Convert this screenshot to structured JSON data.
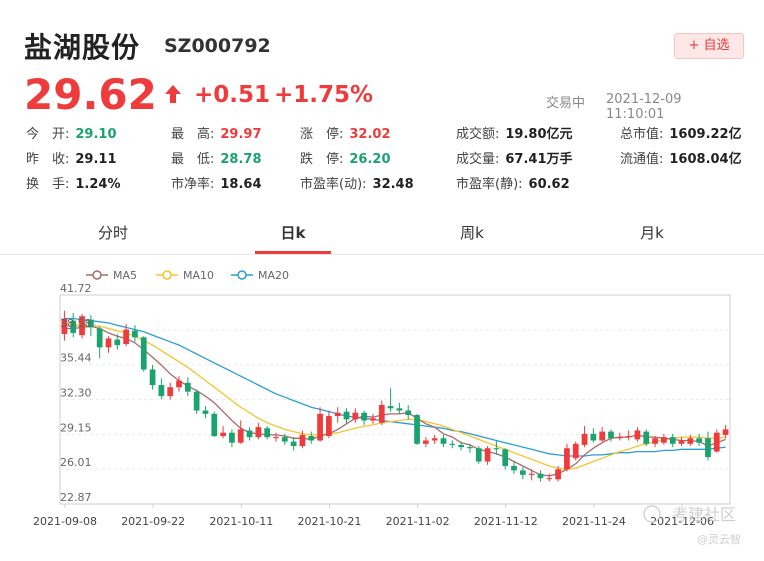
{
  "header": {
    "stock_name": "盐湖股份",
    "stock_code": "SZ000792",
    "add_watch_label": "+ 自选"
  },
  "quote": {
    "price": "29.62",
    "change": "+0.51",
    "change_pct": "+1.75%",
    "status": "交易中",
    "timestamp": "2021-12-09 11:10:01"
  },
  "stats": {
    "open_label": "今　开:",
    "open": "29.10",
    "prev_close_label": "昨　收:",
    "prev_close": "29.11",
    "turnover_rate_label": "换　手:",
    "turnover_rate": "1.24%",
    "high_label": "最　高:",
    "high": "29.97",
    "low_label": "最　低:",
    "low": "28.78",
    "pb_label": "市净率:",
    "pb": "18.64",
    "limit_up_label": "涨　停:",
    "limit_up": "32.02",
    "limit_down_label": "跌　停:",
    "limit_down": "26.20",
    "pe_dyn_label": "市盈率(动):",
    "pe_dyn": "32.48",
    "amount_label": "成交额:",
    "amount": "19.80亿元",
    "volume_label": "成交量:",
    "volume": "67.41万手",
    "pe_static_label": "市盈率(静):",
    "pe_static": "60.62",
    "market_cap_label": "总市值:",
    "market_cap": "1609.22亿",
    "float_cap_label": "流通值:",
    "float_cap": "1608.04亿"
  },
  "tabs": [
    "分时",
    "日k",
    "周k",
    "月k"
  ],
  "active_tab": "日k",
  "watermark": {
    "brand": "考建社区",
    "author": "@灵云智"
  },
  "colors": {
    "up": "#ef3b3b",
    "down": "#1aa36f",
    "ma5": "#a86b6b",
    "ma10": "#f5c431",
    "ma20": "#2a9fd0"
  },
  "chart_data": {
    "type": "candlestick",
    "legend": [
      "MA5",
      "MA10",
      "MA20"
    ],
    "y_ticks": [
      "41.72",
      "38.58",
      "35.44",
      "32.30",
      "29.15",
      "26.01",
      "22.87"
    ],
    "ylim": [
      22.87,
      41.72
    ],
    "x_ticks": [
      "2021-09-08",
      "2021-09-22",
      "2021-10-11",
      "2021-10-21",
      "2021-11-02",
      "2021-11-12",
      "2021-11-24",
      "2021-12-06"
    ],
    "candles": [
      {
        "o": 38.2,
        "c": 39.6,
        "h": 40.3,
        "l": 37.6
      },
      {
        "o": 39.4,
        "c": 38.3,
        "h": 40.1,
        "l": 37.9
      },
      {
        "o": 38.1,
        "c": 39.8,
        "h": 40.0,
        "l": 37.8
      },
      {
        "o": 39.5,
        "c": 38.8,
        "h": 39.9,
        "l": 38.0
      },
      {
        "o": 38.7,
        "c": 37.0,
        "h": 38.9,
        "l": 36.0
      },
      {
        "o": 37.0,
        "c": 37.8,
        "h": 38.0,
        "l": 36.5
      },
      {
        "o": 37.7,
        "c": 37.2,
        "h": 38.2,
        "l": 36.8
      },
      {
        "o": 37.3,
        "c": 38.6,
        "h": 39.1,
        "l": 37.1
      },
      {
        "o": 38.5,
        "c": 37.9,
        "h": 39.0,
        "l": 37.5
      },
      {
        "o": 37.9,
        "c": 35.0,
        "h": 38.0,
        "l": 34.8
      },
      {
        "o": 35.0,
        "c": 33.6,
        "h": 35.4,
        "l": 33.2
      },
      {
        "o": 33.6,
        "c": 32.6,
        "h": 34.2,
        "l": 32.3
      },
      {
        "o": 32.6,
        "c": 33.4,
        "h": 33.8,
        "l": 32.3
      },
      {
        "o": 33.4,
        "c": 34.0,
        "h": 34.4,
        "l": 33.0
      },
      {
        "o": 33.8,
        "c": 33.0,
        "h": 34.3,
        "l": 32.6
      },
      {
        "o": 33.0,
        "c": 31.3,
        "h": 33.2,
        "l": 31.0
      },
      {
        "o": 31.3,
        "c": 31.0,
        "h": 31.7,
        "l": 30.6
      },
      {
        "o": 31.0,
        "c": 29.0,
        "h": 31.2,
        "l": 28.9
      },
      {
        "o": 29.0,
        "c": 29.3,
        "h": 29.9,
        "l": 28.8
      },
      {
        "o": 29.3,
        "c": 28.4,
        "h": 29.6,
        "l": 28.0
      },
      {
        "o": 28.4,
        "c": 29.6,
        "h": 30.4,
        "l": 28.3
      },
      {
        "o": 29.5,
        "c": 28.9,
        "h": 29.8,
        "l": 28.6
      },
      {
        "o": 28.9,
        "c": 29.8,
        "h": 30.2,
        "l": 28.7
      },
      {
        "o": 29.7,
        "c": 28.9,
        "h": 29.9,
        "l": 28.7
      },
      {
        "o": 28.9,
        "c": 28.9,
        "h": 29.3,
        "l": 28.5
      },
      {
        "o": 28.9,
        "c": 28.5,
        "h": 29.2,
        "l": 28.2
      },
      {
        "o": 28.5,
        "c": 28.1,
        "h": 28.9,
        "l": 27.7
      },
      {
        "o": 28.1,
        "c": 29.1,
        "h": 29.5,
        "l": 27.9
      },
      {
        "o": 29.0,
        "c": 28.6,
        "h": 29.4,
        "l": 28.3
      },
      {
        "o": 28.6,
        "c": 31.0,
        "h": 31.6,
        "l": 28.5
      },
      {
        "o": 29.0,
        "c": 30.8,
        "h": 31.3,
        "l": 28.8
      },
      {
        "o": 30.8,
        "c": 31.1,
        "h": 31.6,
        "l": 30.2
      },
      {
        "o": 31.2,
        "c": 30.5,
        "h": 31.5,
        "l": 30.1
      },
      {
        "o": 30.5,
        "c": 31.1,
        "h": 31.5,
        "l": 30.2
      },
      {
        "o": 31.1,
        "c": 30.4,
        "h": 31.3,
        "l": 30.0
      },
      {
        "o": 30.4,
        "c": 30.6,
        "h": 31.0,
        "l": 30.1
      },
      {
        "o": 30.2,
        "c": 31.8,
        "h": 32.2,
        "l": 30.0
      },
      {
        "o": 31.7,
        "c": 31.5,
        "h": 33.3,
        "l": 31.2
      },
      {
        "o": 31.5,
        "c": 31.3,
        "h": 32.0,
        "l": 31.0
      },
      {
        "o": 31.3,
        "c": 30.9,
        "h": 31.8,
        "l": 30.5
      },
      {
        "o": 30.9,
        "c": 28.3,
        "h": 31.0,
        "l": 28.2
      },
      {
        "o": 28.3,
        "c": 28.6,
        "h": 28.9,
        "l": 28.0
      },
      {
        "o": 28.6,
        "c": 28.8,
        "h": 29.1,
        "l": 28.3
      },
      {
        "o": 28.8,
        "c": 28.3,
        "h": 29.1,
        "l": 28.0
      },
      {
        "o": 28.3,
        "c": 28.2,
        "h": 28.6,
        "l": 27.9
      },
      {
        "o": 28.2,
        "c": 28.0,
        "h": 28.5,
        "l": 27.7
      },
      {
        "o": 28.0,
        "c": 27.9,
        "h": 28.3,
        "l": 27.5
      },
      {
        "o": 27.9,
        "c": 26.7,
        "h": 28.1,
        "l": 26.5
      },
      {
        "o": 26.7,
        "c": 27.9,
        "h": 28.1,
        "l": 26.4
      },
      {
        "o": 27.9,
        "c": 27.8,
        "h": 28.6,
        "l": 27.3
      },
      {
        "o": 27.8,
        "c": 26.3,
        "h": 27.9,
        "l": 26.0
      },
      {
        "o": 26.3,
        "c": 25.9,
        "h": 26.7,
        "l": 25.6
      },
      {
        "o": 25.9,
        "c": 25.5,
        "h": 26.2,
        "l": 25.1
      },
      {
        "o": 25.5,
        "c": 25.6,
        "h": 26.0,
        "l": 25.0
      },
      {
        "o": 25.6,
        "c": 25.2,
        "h": 25.9,
        "l": 24.9
      },
      {
        "o": 25.2,
        "c": 25.2,
        "h": 25.6,
        "l": 24.9
      },
      {
        "o": 25.1,
        "c": 26.0,
        "h": 26.3,
        "l": 24.9
      },
      {
        "o": 26.0,
        "c": 27.9,
        "h": 28.3,
        "l": 25.8
      },
      {
        "o": 27.0,
        "c": 28.3,
        "h": 28.5,
        "l": 26.8
      },
      {
        "o": 28.2,
        "c": 29.2,
        "h": 29.9,
        "l": 28.0
      },
      {
        "o": 29.2,
        "c": 28.6,
        "h": 29.7,
        "l": 28.4
      },
      {
        "o": 28.6,
        "c": 29.4,
        "h": 29.8,
        "l": 28.5
      },
      {
        "o": 29.4,
        "c": 28.8,
        "h": 29.6,
        "l": 28.5
      },
      {
        "o": 28.8,
        "c": 28.9,
        "h": 29.3,
        "l": 28.6
      },
      {
        "o": 28.9,
        "c": 29.0,
        "h": 29.5,
        "l": 28.6
      },
      {
        "o": 28.7,
        "c": 29.5,
        "h": 29.8,
        "l": 28.5
      },
      {
        "o": 29.4,
        "c": 28.3,
        "h": 29.6,
        "l": 28.1
      },
      {
        "o": 28.3,
        "c": 28.8,
        "h": 29.0,
        "l": 28.0
      },
      {
        "o": 28.4,
        "c": 28.9,
        "h": 29.2,
        "l": 28.2
      },
      {
        "o": 28.9,
        "c": 28.3,
        "h": 29.2,
        "l": 28.0
      },
      {
        "o": 28.3,
        "c": 28.6,
        "h": 28.9,
        "l": 28.1
      },
      {
        "o": 28.3,
        "c": 28.8,
        "h": 29.1,
        "l": 28.1
      },
      {
        "o": 28.8,
        "c": 28.4,
        "h": 29.2,
        "l": 28.1
      },
      {
        "o": 28.8,
        "c": 27.1,
        "h": 29.4,
        "l": 26.8
      },
      {
        "o": 27.6,
        "c": 29.3,
        "h": 29.6,
        "l": 27.5
      },
      {
        "o": 29.1,
        "c": 29.6,
        "h": 30.0,
        "l": 28.8
      }
    ],
    "ma5": [
      38.7,
      38.7,
      38.8,
      38.9,
      38.7,
      38.3,
      38.0,
      37.8,
      37.4,
      36.8,
      36.1,
      35.4,
      34.6,
      34.0,
      33.5,
      33.1,
      32.6,
      32.0,
      31.2,
      30.4,
      29.7,
      29.3,
      29.2,
      29.1,
      29.1,
      29.0,
      28.8,
      28.8,
      28.7,
      29.0,
      29.2,
      29.6,
      30.1,
      30.6,
      30.8,
      30.7,
      30.9,
      31.0,
      31.0,
      31.1,
      30.6,
      30.1,
      29.8,
      29.2,
      28.9,
      28.4,
      28.2,
      27.8,
      27.6,
      27.4,
      27.1,
      26.7,
      26.3,
      25.9,
      25.5,
      25.4,
      25.6,
      26.0,
      26.5,
      27.3,
      27.9,
      28.4,
      28.8,
      28.9,
      28.9,
      29.1,
      28.9,
      28.9,
      28.8,
      28.7,
      28.6,
      28.6,
      28.5,
      28.1,
      28.4,
      28.7
    ],
    "ma10": [
      39.0,
      39.0,
      39.0,
      39.0,
      38.9,
      38.7,
      38.5,
      38.3,
      38.0,
      37.6,
      37.2,
      36.7,
      36.2,
      35.7,
      35.2,
      34.6,
      34.0,
      33.4,
      32.8,
      32.2,
      31.6,
      31.1,
      30.6,
      30.2,
      29.9,
      29.6,
      29.4,
      29.2,
      29.1,
      29.1,
      29.2,
      29.3,
      29.5,
      29.7,
      29.9,
      30.0,
      30.2,
      30.3,
      30.4,
      30.5,
      30.5,
      30.3,
      30.1,
      29.9,
      29.6,
      29.3,
      29.0,
      28.7,
      28.4,
      28.1,
      27.8,
      27.5,
      27.2,
      26.9,
      26.6,
      26.3,
      26.1,
      26.0,
      26.1,
      26.4,
      26.7,
      27.0,
      27.3,
      27.6,
      27.8,
      28.1,
      28.3,
      28.5,
      28.7,
      28.8,
      28.9,
      28.9,
      28.9,
      28.8,
      28.8,
      28.9
    ],
    "ma20": [
      39.6,
      39.6,
      39.5,
      39.4,
      39.3,
      39.2,
      39.0,
      38.8,
      38.6,
      38.4,
      38.1,
      37.8,
      37.5,
      37.2,
      36.8,
      36.4,
      36.0,
      35.6,
      35.2,
      34.8,
      34.4,
      34.0,
      33.6,
      33.2,
      32.8,
      32.5,
      32.2,
      31.9,
      31.6,
      31.4,
      31.2,
      31.0,
      30.8,
      30.7,
      30.6,
      30.5,
      30.4,
      30.3,
      30.2,
      30.1,
      30.0,
      29.9,
      29.8,
      29.7,
      29.5,
      29.4,
      29.2,
      29.0,
      28.8,
      28.6,
      28.4,
      28.2,
      28.0,
      27.8,
      27.6,
      27.4,
      27.3,
      27.2,
      27.2,
      27.2,
      27.3,
      27.3,
      27.4,
      27.5,
      27.5,
      27.6,
      27.6,
      27.6,
      27.7,
      27.7,
      27.8,
      27.8,
      27.8,
      27.8,
      27.9,
      28.0
    ]
  }
}
